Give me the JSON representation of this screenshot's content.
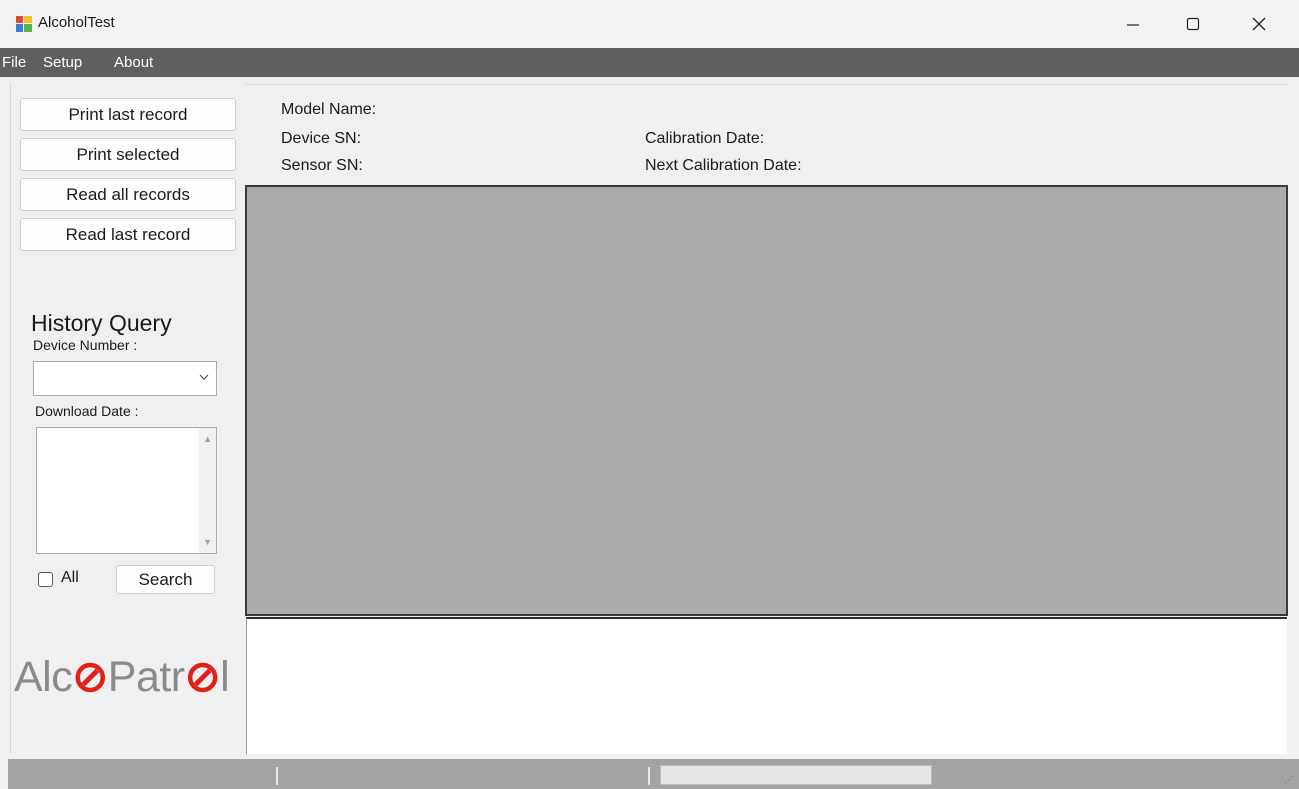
{
  "window": {
    "title": "AlcoholTest"
  },
  "menu": {
    "items": [
      "File",
      "Setup",
      "About"
    ]
  },
  "left": {
    "buttons": [
      "Print last record",
      "Print selected",
      "Read all records",
      "Read last record"
    ],
    "history_title": "History Query",
    "device_number_label": "Device Number :",
    "device_number_value": "",
    "download_date_label": "Download Date :",
    "all_label": "All",
    "all_checked": false,
    "search_label": "Search",
    "logo": {
      "part1": "Alc",
      "o1": "⊘",
      "part2": "Patr",
      "o2": "⊘",
      "part3": "l"
    }
  },
  "info": {
    "model_name": "Model Name:",
    "device_sn": "Device SN:",
    "sensor_sn": "Sensor SN:",
    "calibration_date": "Calibration Date:",
    "next_calibration_date": "Next Calibration Date:"
  },
  "statusbar": {
    "progress": 0
  },
  "colors": {
    "menubar": "#5f5f5f",
    "grid": "#ababab",
    "logo_red": "#e0201b",
    "logo_gray": "#8a8a8a"
  }
}
